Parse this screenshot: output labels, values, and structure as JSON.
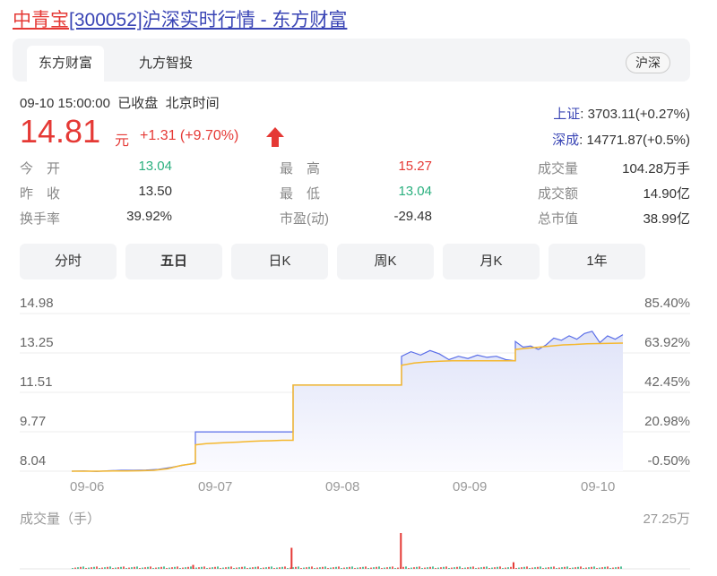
{
  "title": {
    "stock": "中青宝",
    "rest": "[300052]沪深实时行情 - 东方财富"
  },
  "source_tabs": [
    "东方财富",
    "九方智投"
  ],
  "market_pill": "沪深",
  "time": "09-10 15:00:00  已收盘  北京时间",
  "price": "14.81",
  "unit": "元",
  "change": "+1.31 (+9.70%)",
  "indices": [
    {
      "name": "上证",
      "value": ": 3703.11(+0.27%)"
    },
    {
      "name": "深成",
      "value": ": 14771.87(+0.5%)"
    }
  ],
  "stats": [
    {
      "label": "今　开",
      "value": "13.04",
      "color": "#2bb07f"
    },
    {
      "label": "昨　收",
      "value": "13.50",
      "color": "#333333"
    },
    {
      "label": "换手率",
      "value": "39.92%",
      "color": "#333333"
    },
    {
      "label": "最　高",
      "value": "15.27",
      "color": "#e53935"
    },
    {
      "label": "最　低",
      "value": "13.04",
      "color": "#2bb07f"
    },
    {
      "label": "市盈(动)",
      "value": "-29.48",
      "color": "#333333"
    },
    {
      "label": "成交量",
      "value": "104.28万手",
      "color": "#333333"
    },
    {
      "label": "成交额",
      "value": "14.90亿",
      "color": "#333333"
    },
    {
      "label": "总市值",
      "value": "38.99亿",
      "color": "#333333"
    }
  ],
  "period_buttons": [
    "分时",
    "五日",
    "日K",
    "周K",
    "月K",
    "1年"
  ],
  "selected_period": "五日",
  "chart_data": {
    "type": "line",
    "y_left_ticks": [
      "14.98",
      "13.25",
      "11.51",
      "9.77",
      "8.04"
    ],
    "y_right_ticks": [
      "85.40%",
      "63.92%",
      "42.45%",
      "20.98%",
      "-0.50%"
    ],
    "ylim": [
      8.04,
      14.98
    ],
    "x_labels": [
      "09-06",
      "09-07",
      "09-08",
      "09-09",
      "09-10"
    ],
    "volume_label": "成交量（手）",
    "volume_max": "27.25万",
    "price": [
      [
        8.04,
        8.05,
        8.03,
        8.06,
        8.08,
        8.08,
        8.09,
        8.12,
        8.2,
        8.3,
        8.4
      ],
      [
        9.77,
        9.77,
        9.77,
        9.77,
        9.77,
        9.77,
        9.77,
        9.77,
        9.77,
        9.77
      ],
      [
        11.83,
        11.83,
        11.83,
        11.83,
        11.83,
        11.83,
        11.83,
        11.83,
        11.83,
        11.83
      ],
      [
        13.1,
        13.3,
        13.15,
        13.35,
        13.2,
        12.95,
        13.1,
        13.0,
        13.15,
        13.05,
        13.1,
        12.95,
        12.9
      ],
      [
        13.75,
        13.5,
        13.55,
        13.4,
        13.6,
        13.9,
        13.8,
        14.0,
        13.85,
        14.1,
        14.2,
        13.7,
        14.0,
        13.85,
        14.05
      ]
    ],
    "average": [
      [
        8.04,
        8.04,
        8.04,
        8.05,
        8.05,
        8.06,
        8.08,
        8.15,
        8.3,
        8.38
      ],
      [
        9.2,
        9.25,
        9.28,
        9.3,
        9.32,
        9.35,
        9.37,
        9.38,
        9.4,
        9.4
      ],
      [
        11.83,
        11.83,
        11.83,
        11.83,
        11.83,
        11.83,
        11.83,
        11.83,
        11.83,
        11.83
      ],
      [
        12.7,
        12.8,
        12.85,
        12.88,
        12.9,
        12.9,
        12.9,
        12.9,
        12.9,
        12.9
      ],
      [
        13.4,
        13.45,
        13.5,
        13.55,
        13.6,
        13.62,
        13.65,
        13.66,
        13.67,
        13.68
      ]
    ],
    "volume_spikes": [
      {
        "day": 0,
        "pos": 0.98,
        "value": 3
      },
      {
        "day": 1,
        "pos": 0.98,
        "value": 16
      },
      {
        "day": 2,
        "pos": 0.99,
        "value": 27.25
      },
      {
        "day": 3,
        "pos": 0.98,
        "value": 5
      }
    ],
    "colors": {
      "price": "#5a6ee8",
      "average": "#f5b82e",
      "fill": "#dfe3f8",
      "up": "#e53935",
      "down": "#2bb07f"
    }
  }
}
